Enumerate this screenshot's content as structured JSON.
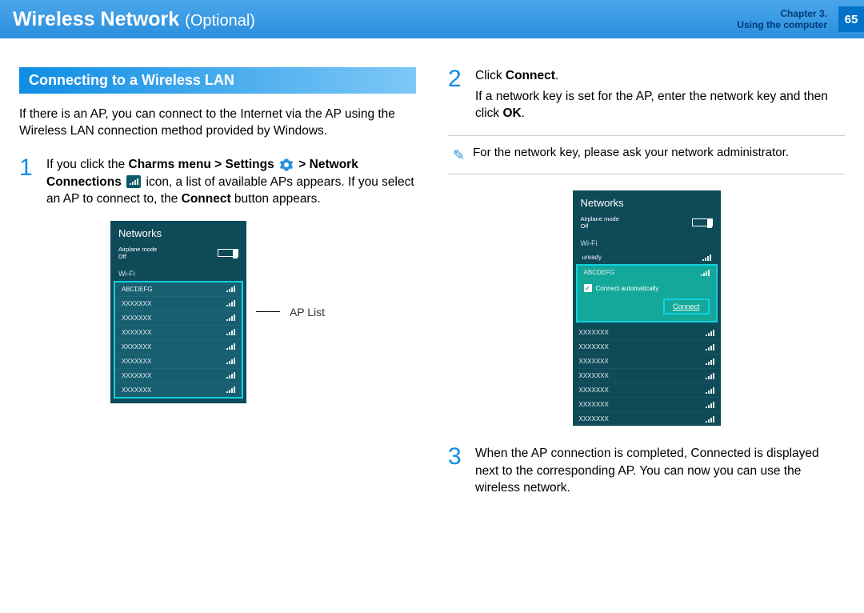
{
  "header": {
    "title": "Wireless Network",
    "subtitle": "(Optional)",
    "chapter_line1": "Chapter 3.",
    "chapter_line2": "Using the computer",
    "page_number": "65"
  },
  "left": {
    "section_heading": "Connecting to a Wireless LAN",
    "intro": "If there is an AP, you can connect to the Internet via the AP using the Wireless LAN connection method provided by Windows.",
    "step1_no": "1",
    "step1_pre": "If you click the ",
    "step1_b1": "Charms menu > Settings",
    "step1_mid": " > ",
    "step1_b2": "Network Connections",
    "step1_post": " icon, a list of available APs appears. If you select an AP to connect to, the ",
    "step1_b3": "Connect",
    "step1_end": " button appears.",
    "ap_list_label": "AP List"
  },
  "right": {
    "step2_no": "2",
    "step2_pre": "Click ",
    "step2_b1": "Connect",
    "step2_post1": ".",
    "step2_line2_pre": "If a network key is set for the AP, enter the network key and then click ",
    "step2_b2": "OK",
    "step2_line2_post": ".",
    "note": "For the network key, please ask your network administrator.",
    "step3_no": "3",
    "step3_text": "When the AP connection is completed, Connected is displayed next to the corresponding AP. You can now you can use the wireless network."
  },
  "panel": {
    "title": "Networks",
    "airplane_label": "Airplane mode",
    "airplane_state": "Off",
    "wifi_label": "Wi-Fi",
    "aps1": [
      "ABCDEFG",
      "XXXXXXX",
      "XXXXXXX",
      "XXXXXXX",
      "XXXXXXX",
      "XXXXXXX",
      "XXXXXXX",
      "XXXXXXX"
    ]
  },
  "panel2": {
    "title": "Networks",
    "airplane_label": "Airplane mode",
    "airplane_state": "Off",
    "wifi_label": "Wi-Fi",
    "uready": "uready",
    "selected": "ABCDEFG",
    "auto_label": "Connect automatically",
    "connect_btn": "Connect",
    "aps": [
      "XXXXXXX",
      "XXXXXXX",
      "XXXXXXX",
      "XXXXXXX",
      "XXXXXXX",
      "XXXXXXX",
      "XXXXXXX"
    ]
  }
}
